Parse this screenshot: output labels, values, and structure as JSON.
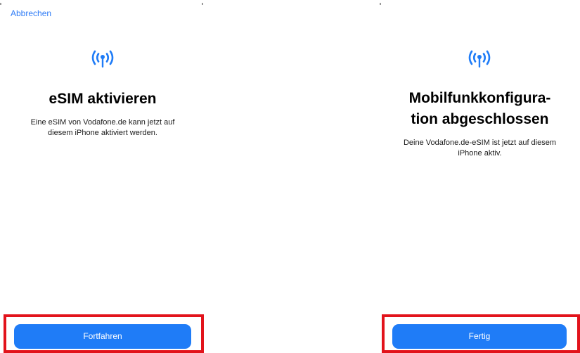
{
  "accent_color": "#1f7cf7",
  "highlight_color": "#e2131b",
  "left_screen": {
    "cancel_label": "Abbrechen",
    "icon": "cellular-antenna-icon",
    "title": "eSIM aktivieren",
    "body_lines": [
      "Eine eSIM von Vodafone.de kann jetzt auf",
      "diesem iPhone aktiviert werden."
    ],
    "button_label": "Fortfahren"
  },
  "right_screen": {
    "icon": "cellular-antenna-icon",
    "title_lines": [
      "Mobilfunkkonfigura-",
      "tion abgeschlossen"
    ],
    "body_lines": [
      "Deine Vodafone.de-eSIM ist jetzt auf diesem",
      "iPhone aktiv."
    ],
    "button_label": "Fertig"
  }
}
